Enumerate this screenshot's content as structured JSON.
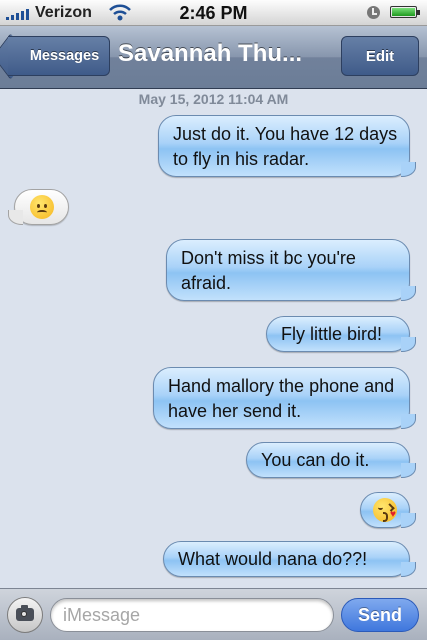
{
  "status_bar": {
    "carrier": "Verizon",
    "time": "2:46 PM",
    "signal_icon": "signal-bars-icon",
    "wifi_icon": "wifi-icon",
    "lock_icon": "rotation-lock-icon",
    "battery_icon": "battery-icon",
    "battery_level": 1.0
  },
  "nav": {
    "back_label": "Messages",
    "title": "Savannah Thu...",
    "edit_label": "Edit"
  },
  "conversation": {
    "timestamp": "May 15, 2012 11:04 AM",
    "messages": [
      {
        "side": "sent",
        "text": "Just do it.  You have 12 days to fly in his radar."
      },
      {
        "side": "received",
        "emoji": "disappointed-face-icon"
      },
      {
        "side": "sent",
        "text": "Don't miss it bc you're afraid."
      },
      {
        "side": "sent",
        "text": "Fly little bird!"
      },
      {
        "side": "sent",
        "text": "Hand mallory the phone and have her send it."
      },
      {
        "side": "sent",
        "text": "You can do it."
      },
      {
        "side": "sent",
        "emoji": "kissing-face-icon"
      },
      {
        "side": "sent",
        "text": "What would nana do??!"
      }
    ]
  },
  "input_bar": {
    "camera_icon": "camera-icon",
    "placeholder": "iMessage",
    "value": "",
    "send_label": "Send"
  },
  "colors": {
    "nav_bar": "#7889a2",
    "sent_bubble": "#a9d2f8",
    "received_bubble": "#f2f2f2",
    "background": "#dbe2ed",
    "send_button": "#4a80e0"
  }
}
